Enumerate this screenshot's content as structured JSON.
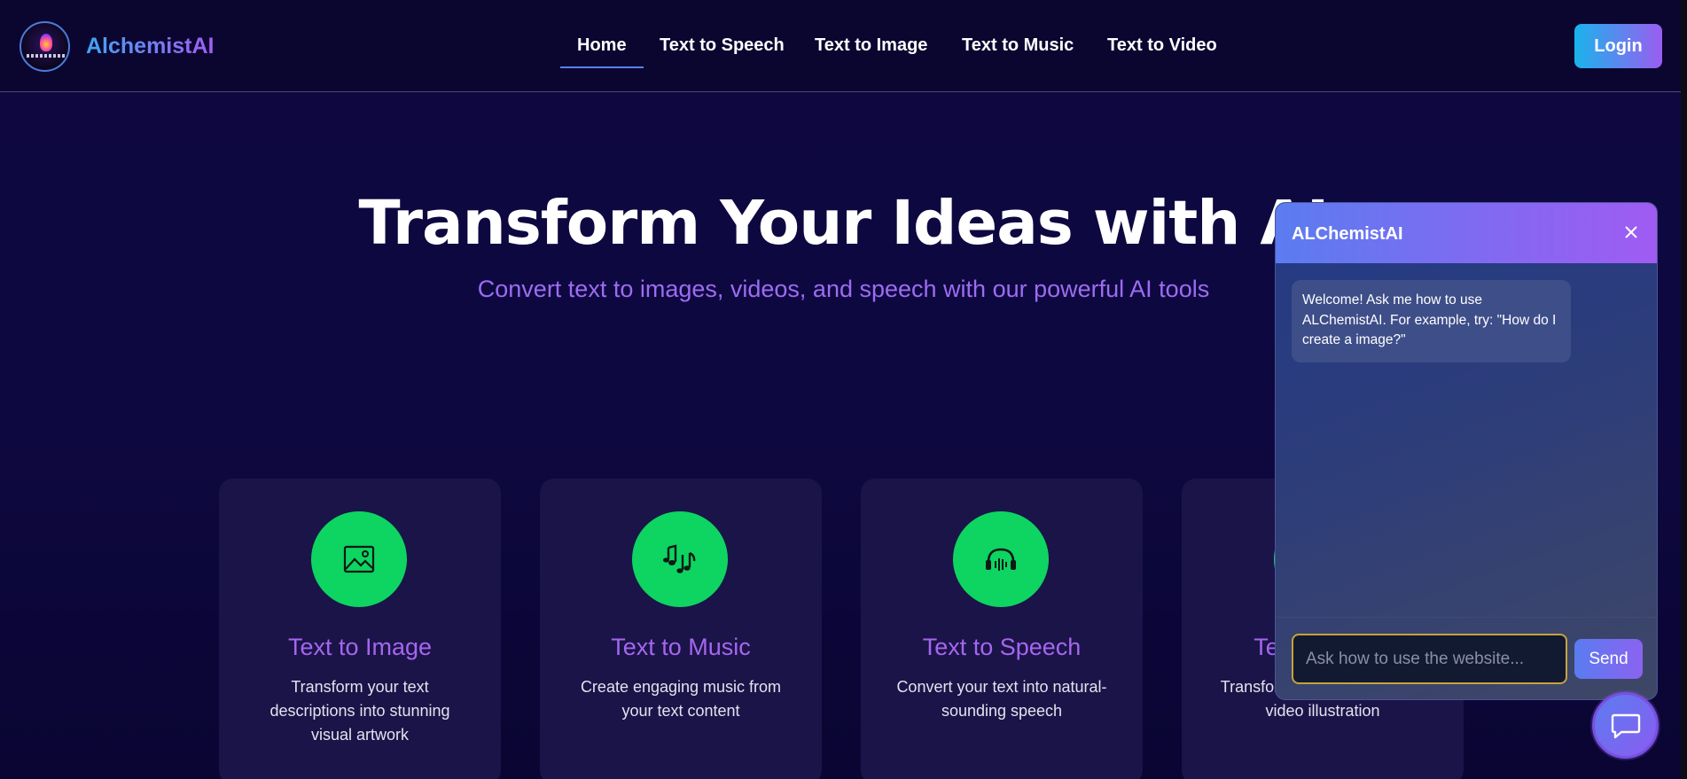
{
  "brand": {
    "name": "AlchemistAI",
    "logo_icon": "alchemist-logo-icon"
  },
  "nav": {
    "items": [
      {
        "label": "Home",
        "active": true
      },
      {
        "label": "Text to Speech",
        "active": false
      },
      {
        "label": "Text to Image",
        "active": false
      },
      {
        "label": "Text to Music",
        "active": false
      },
      {
        "label": "Text to Video",
        "active": false
      }
    ],
    "login_label": "Login"
  },
  "hero": {
    "title": "Transform Your Ideas with AI",
    "subtitle": "Convert text to images, videos, and speech with our powerful AI tools"
  },
  "cards": [
    {
      "title": "Text to Image",
      "description": "Transform your text descriptions into stunning visual artwork",
      "icon": "image-icon"
    },
    {
      "title": "Text to Music",
      "description": "Create engaging music from your text content",
      "icon": "music-notes-icon"
    },
    {
      "title": "Text to Speech",
      "description": "Convert your text into natural-sounding speech",
      "icon": "headphones-icon"
    },
    {
      "title": "Text to Video",
      "description": "Transform your text into vivid video illustration",
      "icon": "video-icon"
    }
  ],
  "chat": {
    "title": "ALChemistAI",
    "welcome_message": "Welcome! Ask me how to use ALChemistAI. For example, try: \"How do I create a image?\"",
    "input_placeholder": "Ask how to use the website...",
    "send_label": "Send",
    "close_icon": "close-icon",
    "fab_icon": "chat-bubble-icon"
  },
  "colors": {
    "background": "#0c0636",
    "accent_green": "#0ed462",
    "accent_purple": "#a566f0",
    "brand_gradient_start": "#3ea6f2",
    "brand_gradient_end": "#a45cf2"
  }
}
